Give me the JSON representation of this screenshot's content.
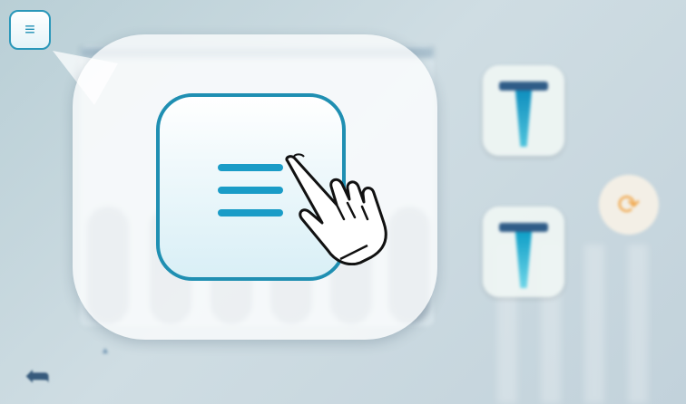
{
  "colors": {
    "accent": "#1f8fb2",
    "menu_bars": "#1a9cc7",
    "background": "#c2d2db",
    "orange": "#f0a64a",
    "dark_blue": "#2f5c88"
  },
  "menu_button": {
    "icon": "hamburger-menu-icon",
    "glyph": "≡"
  },
  "zoom_callout": {
    "icon": "hamburger-menu-icon",
    "pointer_icon": "hand-pointer-icon"
  },
  "background_app": {
    "back_icon": "back-arrow-icon",
    "back_glyph": "➦",
    "refresh_icon": "refresh-icon",
    "refresh_glyph": "⟳",
    "tube_icons": [
      "test-tube-icon",
      "test-tube-icon"
    ]
  }
}
